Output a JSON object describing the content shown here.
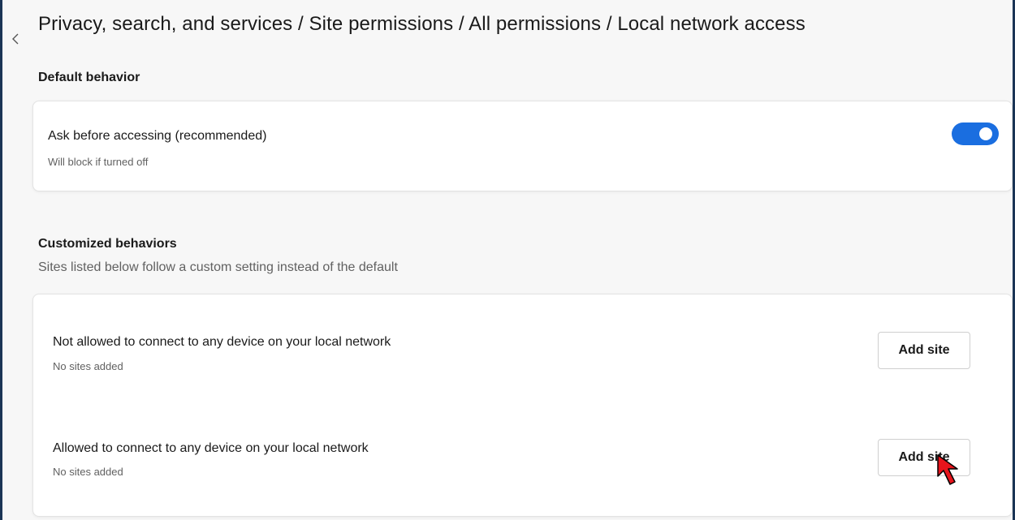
{
  "header": {
    "title": "Privacy, search, and services / Site permissions / All permissions / Local network access",
    "back_icon": "chevron-left-icon"
  },
  "default_behavior": {
    "heading": "Default behavior",
    "setting": {
      "label": "Ask before accessing (recommended)",
      "description": "Will block if turned off",
      "toggle_on": true,
      "toggle_color": "#1a6ee0"
    }
  },
  "customized_behaviors": {
    "heading": "Customized behaviors",
    "subheading": "Sites listed below follow a custom setting instead of the default",
    "items": [
      {
        "label": "Not allowed to connect to any device on your local network",
        "status": "No sites added",
        "button_label": "Add site"
      },
      {
        "label": "Allowed to connect to any device on your local network",
        "status": "No sites added",
        "button_label": "Add site"
      }
    ]
  },
  "cursor": {
    "icon": "red-arrow-cursor-icon",
    "color": "#e8141c"
  }
}
